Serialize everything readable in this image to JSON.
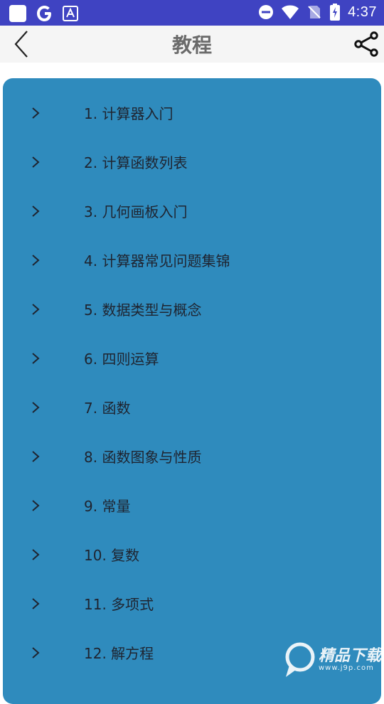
{
  "status_bar": {
    "time": "4:37"
  },
  "app_bar": {
    "title": "教程"
  },
  "tutorial_list": [
    {
      "label": "1. 计算器入门"
    },
    {
      "label": "2. 计算函数列表"
    },
    {
      "label": "3. 几何画板入门"
    },
    {
      "label": "4. 计算器常见问题集锦"
    },
    {
      "label": "5. 数据类型与概念"
    },
    {
      "label": "6. 四则运算"
    },
    {
      "label": "7. 函数"
    },
    {
      "label": "8. 函数图象与性质"
    },
    {
      "label": "9. 常量"
    },
    {
      "label": "10. 复数"
    },
    {
      "label": "11. 多项式"
    },
    {
      "label": "12. 解方程"
    }
  ],
  "watermark": {
    "title": "精品下载",
    "url": "www.j9p.com"
  },
  "colors": {
    "status_bar": "#3f43c2",
    "app_bar": "#f5f5f5",
    "panel": "#2f8bbd",
    "title_text": "#6a6a6a",
    "item_text": "#1f2430"
  },
  "icons": {
    "back": "chevron-left-icon",
    "share": "share-icon",
    "item_chevron": "chevron-right-icon"
  }
}
